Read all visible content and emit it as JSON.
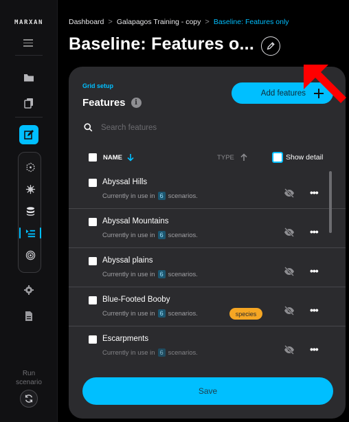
{
  "app": {
    "logo": "MARXAN"
  },
  "breadcrumb": {
    "items": [
      "Dashboard",
      "Galapagos Training - copy",
      "Baseline: Features only"
    ]
  },
  "page_title": "Baseline: Features o...",
  "panel": {
    "section_label": "Grid setup",
    "title": "Features",
    "info_glyph": "i",
    "add_button_label": "Add features",
    "search_placeholder": "Search features",
    "columns": {
      "name": "NAME",
      "type": "TYPE"
    },
    "show_detail_label": "Show detail",
    "usage_prefix": "Currently in use in",
    "usage_suffix": "scenarios.",
    "rows": [
      {
        "name": "Abyssal Hills",
        "count": "6",
        "badge": ""
      },
      {
        "name": "Abyssal Mountains",
        "count": "6",
        "badge": ""
      },
      {
        "name": "Abyssal plains",
        "count": "6",
        "badge": ""
      },
      {
        "name": "Blue-Footed Booby",
        "count": "6",
        "badge": "species"
      },
      {
        "name": "Escarpments",
        "count": "6",
        "badge": ""
      }
    ],
    "more_glyph": "•••",
    "save_label": "Save"
  },
  "sidebar": {
    "run_label": "Run scenario"
  },
  "colors": {
    "accent": "#00bfff",
    "badge": "#f5a623",
    "panel": "#2b2b2e",
    "annotation_arrow": "#ff0000"
  }
}
